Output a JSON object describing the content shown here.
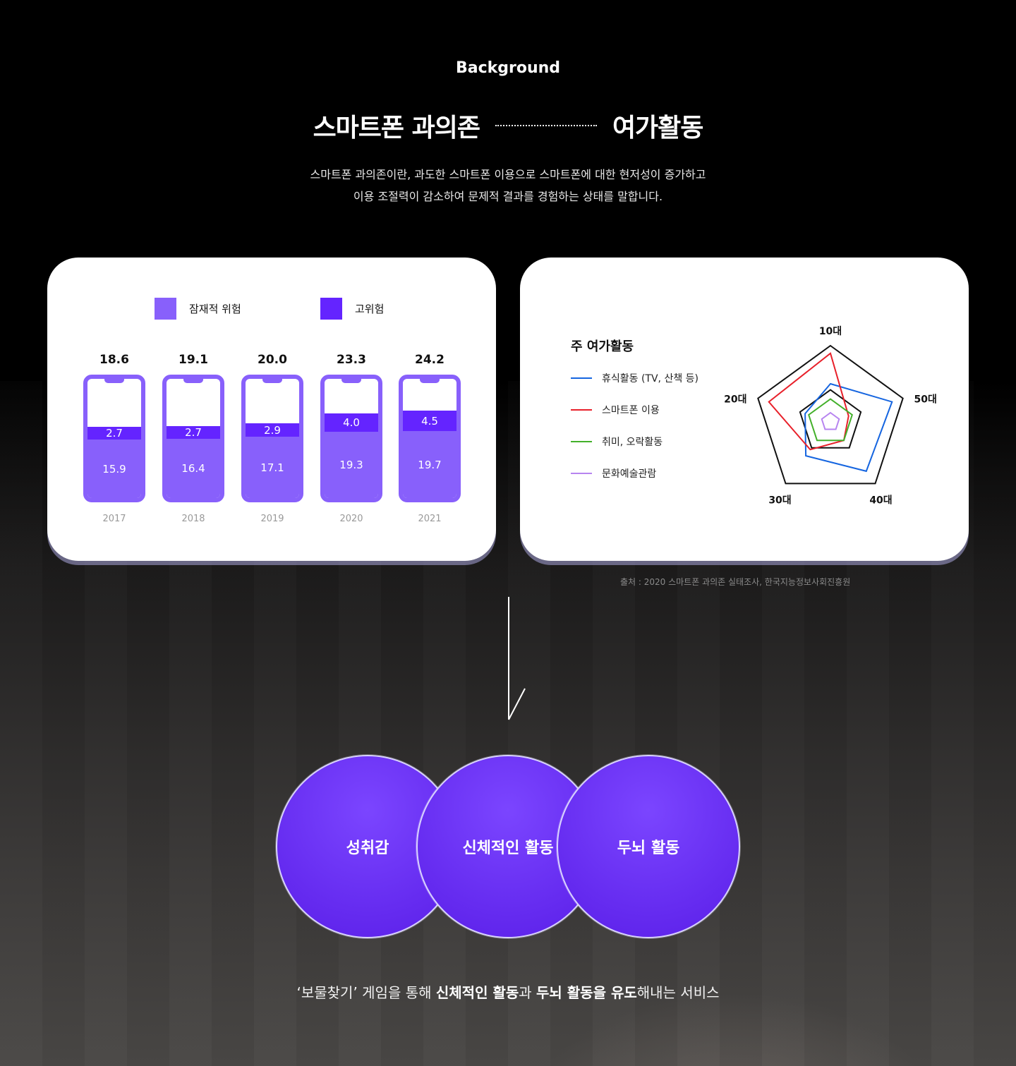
{
  "header": {
    "eyebrow": "Background",
    "title_left": "스마트폰 과의존",
    "title_right": "여가활동",
    "description_line1": "스마트폰 과의존이란, 과도한 스마트폰 이용으로 스마트폰에 대한 현저성이 증가하고",
    "description_line2": "이용 조절력이 감소하여 문제적 결과를 경험하는 상태를 말합니다."
  },
  "colors": {
    "potential": "#8860fb",
    "high": "#6424ff",
    "rest": "#1565e0",
    "smartphone": "#e8202a",
    "hobby": "#43b02a",
    "culture": "#b784f0"
  },
  "chart_data": [
    {
      "type": "bar",
      "categories": [
        "2017",
        "2018",
        "2019",
        "2020",
        "2021"
      ],
      "series": [
        {
          "name": "잠재적 위험",
          "values": [
            15.9,
            16.4,
            17.1,
            19.3,
            19.7
          ]
        },
        {
          "name": "고위험",
          "values": [
            2.7,
            2.7,
            2.9,
            4.0,
            4.5
          ]
        }
      ],
      "totals": [
        "18.6",
        "19.1",
        "20.0",
        "23.3",
        "24.2"
      ],
      "potential_labels": [
        "15.9",
        "16.4",
        "17.1",
        "19.3",
        "19.7"
      ],
      "high_labels": [
        "2.7",
        "2.7",
        "2.9",
        "4.0",
        "4.5"
      ],
      "stacked": true,
      "legend_position": "top"
    },
    {
      "type": "radar",
      "title": "주 여가활동",
      "axes": [
        "10대",
        "50대",
        "40대",
        "30대",
        "20대"
      ],
      "series": [
        {
          "name": "휴식활동 (TV, 산책 등)",
          "values": [
            0.5,
            0.85,
            0.8,
            0.55,
            0.35
          ]
        },
        {
          "name": "스마트폰 이용",
          "values": [
            0.9,
            0.25,
            0.3,
            0.45,
            0.85
          ]
        },
        {
          "name": "취미, 오락활동",
          "values": [
            0.3,
            0.3,
            0.3,
            0.3,
            0.3
          ]
        },
        {
          "name": "문화예술관람",
          "values": [
            0.12,
            0.12,
            0.12,
            0.12,
            0.12
          ]
        }
      ],
      "legend_position": "left"
    }
  ],
  "source": "출처 : 2020 스마트폰 과의존 실태조사, 한국지능정보사회진흥원",
  "circles": [
    "성취감",
    "신체적인 활동",
    "두뇌 활동"
  ],
  "tagline": {
    "part1": "‘보물찾기’ 게임을 통해 ",
    "bold1": "신체적인 활동",
    "part2": "과 ",
    "bold2": "두뇌 활동을 유도",
    "part3": "해내는 서비스"
  }
}
